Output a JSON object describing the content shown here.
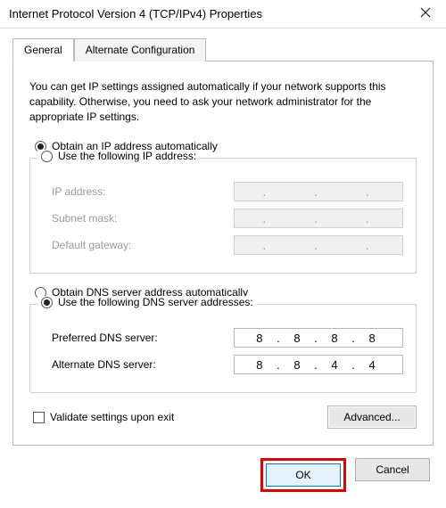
{
  "window": {
    "title": "Internet Protocol Version 4 (TCP/IPv4) Properties"
  },
  "tabs": {
    "general": "General",
    "alternate": "Alternate Configuration"
  },
  "intro": "You can get IP settings assigned automatically if your network supports this capability. Otherwise, you need to ask your network administrator for the appropriate IP settings.",
  "ip": {
    "auto_label": "Obtain an IP address automatically",
    "manual_label": "Use the following IP address:",
    "selected": "auto",
    "fields": {
      "ip_label": "IP address:",
      "ip_value": "   .     .     .   ",
      "mask_label": "Subnet mask:",
      "mask_value": "   .     .     .   ",
      "gw_label": "Default gateway:",
      "gw_value": "   .     .     .   "
    }
  },
  "dns": {
    "auto_label": "Obtain DNS server address automatically",
    "manual_label": "Use the following DNS server addresses:",
    "selected": "manual",
    "fields": {
      "pref_label": "Preferred DNS server:",
      "pref_value": "8 . 8 . 8 . 8",
      "alt_label": "Alternate DNS server:",
      "alt_value": "8 . 8 . 4 . 4"
    }
  },
  "validate": {
    "label": "Validate settings upon exit",
    "checked": false
  },
  "buttons": {
    "advanced": "Advanced...",
    "ok": "OK",
    "cancel": "Cancel"
  }
}
